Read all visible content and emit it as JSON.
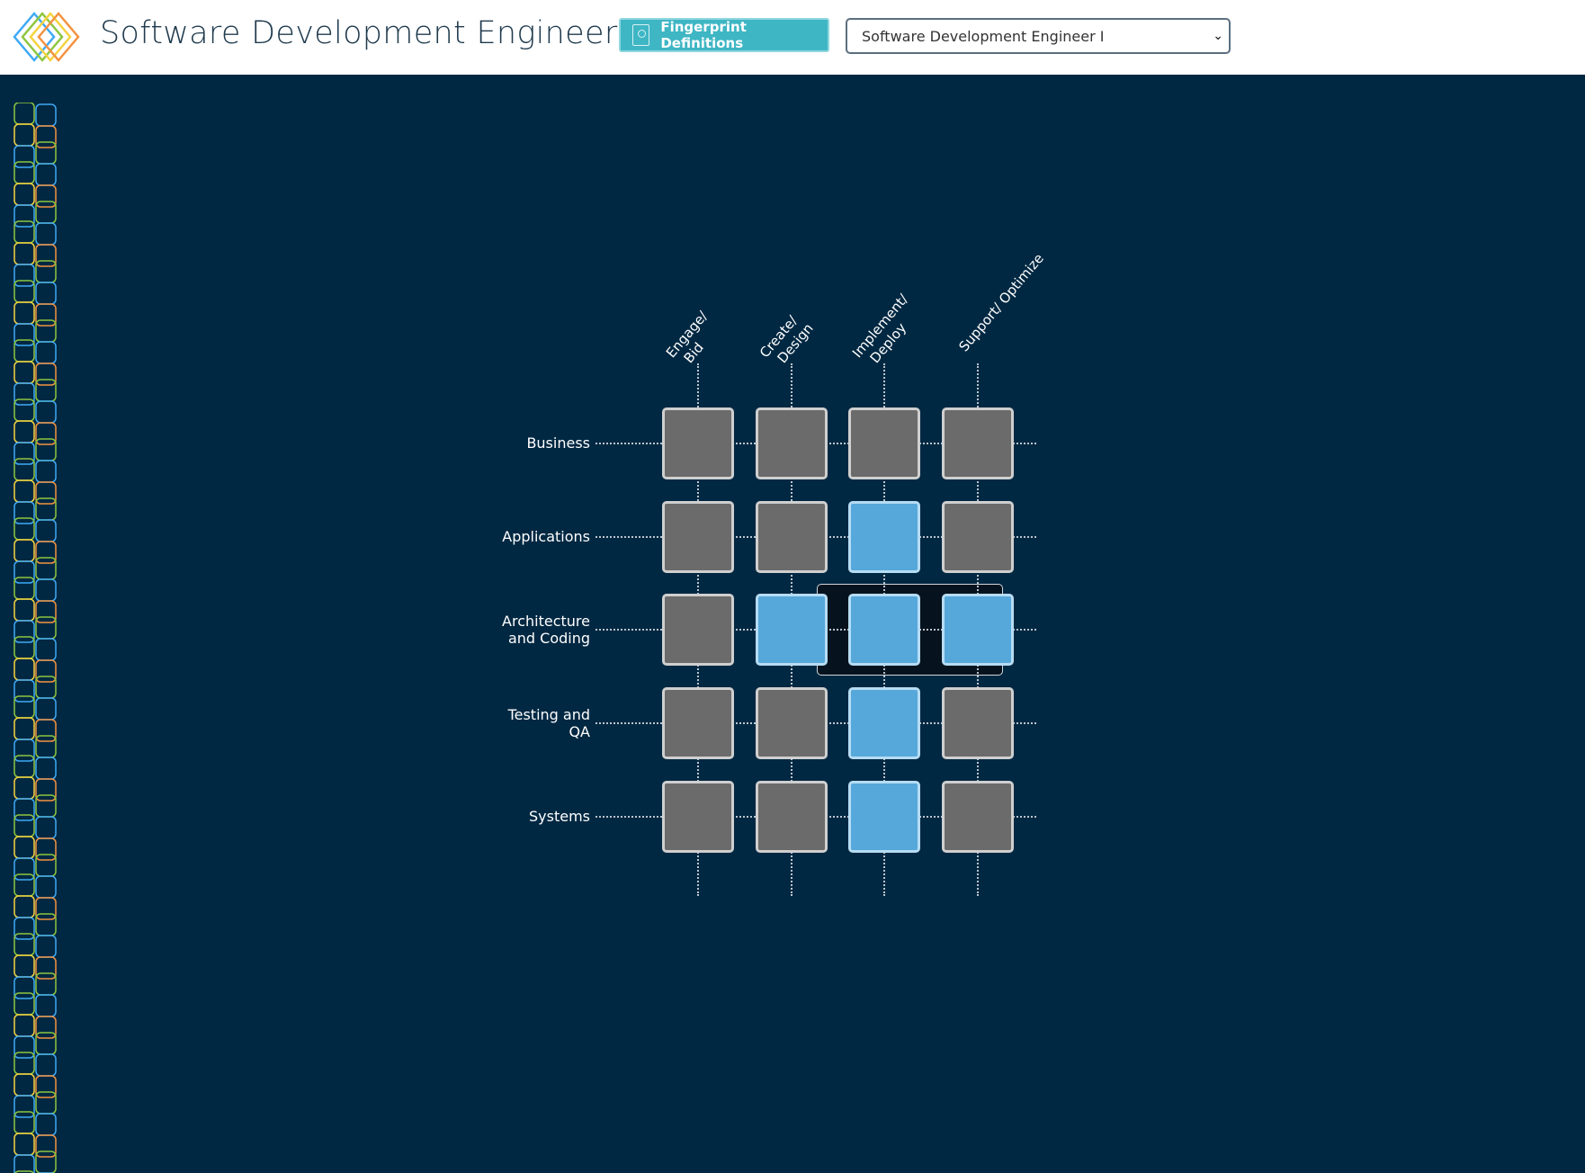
{
  "header": {
    "title": "Software Development Engineer",
    "fingerprint_button": "Fingerprint Definitions",
    "role_select": {
      "selected": "Software Development Engineer I"
    }
  },
  "matrix": {
    "columns": [
      {
        "line1": "Engage/",
        "line2": "Bid"
      },
      {
        "line1": "Create/",
        "line2": "Design"
      },
      {
        "line1": "Implement/",
        "line2": "Deploy"
      },
      {
        "line1": "Support/ Optimize",
        "line2": ""
      }
    ],
    "rows": [
      {
        "line1": "Business",
        "line2": "",
        "cells": [
          false,
          false,
          false,
          false
        ]
      },
      {
        "line1": "Applications",
        "line2": "",
        "cells": [
          false,
          false,
          true,
          false
        ]
      },
      {
        "line1": "Architecture",
        "line2": "and Coding",
        "cells": [
          false,
          true,
          true,
          true
        ]
      },
      {
        "line1": "Testing and",
        "line2": "QA",
        "cells": [
          false,
          false,
          true,
          false
        ]
      },
      {
        "line1": "Systems",
        "line2": "",
        "cells": [
          false,
          false,
          true,
          false
        ]
      }
    ],
    "colors": {
      "active": "#56a8da",
      "inactive": "#6b6b6b",
      "background": "#012842"
    }
  }
}
